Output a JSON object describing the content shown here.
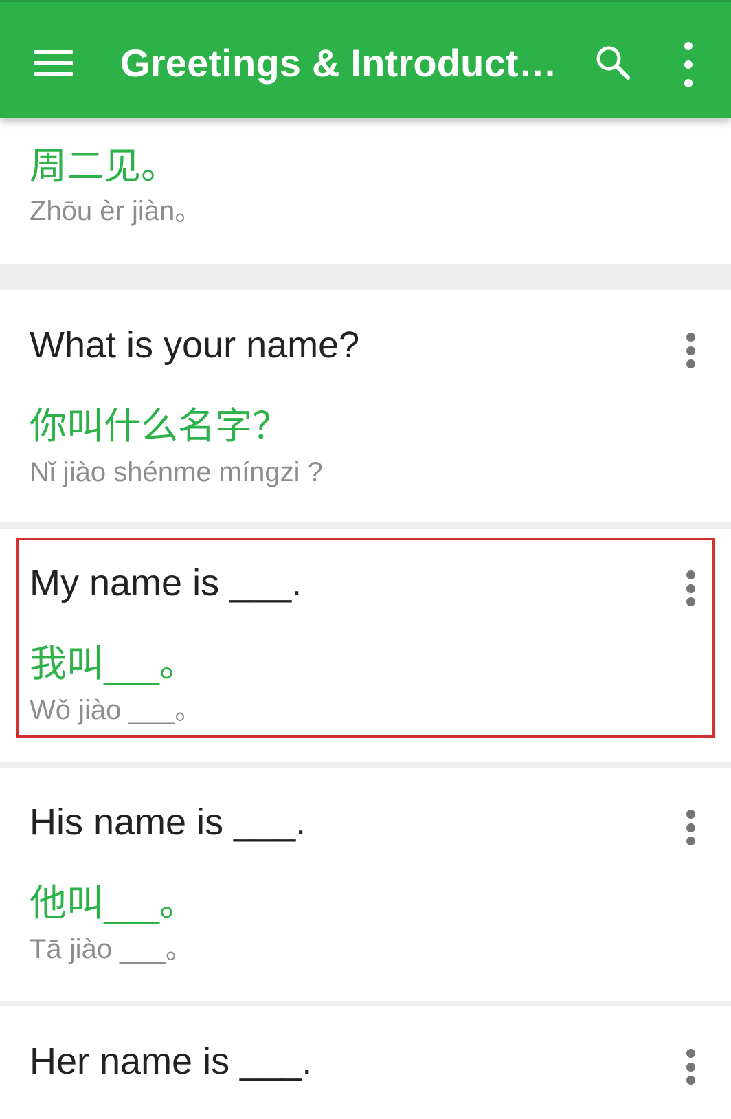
{
  "app_bar": {
    "title": "Greetings & Introducti…",
    "menu_icon": "hamburger-menu-icon",
    "search_icon": "search-icon",
    "overflow_icon": "more-vert-icon",
    "background_color": "#2db24a"
  },
  "phrases": [
    {
      "english": "",
      "chinese": "周二见。",
      "pinyin": "Zhōu èr jiàn。"
    },
    {
      "english": "What is your name?",
      "chinese": "你叫什么名字？",
      "pinyin": "Nǐ jiào shénme míngzi ?"
    },
    {
      "english": "My name is ___.",
      "chinese": "我叫___。",
      "pinyin": "Wǒ jiào ___。",
      "highlighted": true
    },
    {
      "english": "His name is ___.",
      "chinese": "他叫___。",
      "pinyin": "Tā jiào ___。"
    },
    {
      "english": "Her name is ___."
    }
  ],
  "colors": {
    "accent": "#2db24a",
    "highlight_border": "#d32f2f",
    "pinyin_text": "#8d8d8d"
  }
}
